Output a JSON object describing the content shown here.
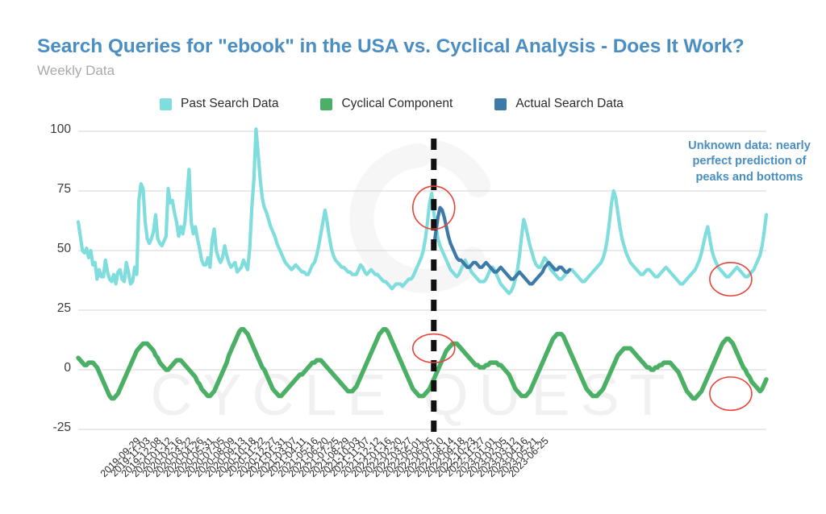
{
  "header": {
    "title": "Search Queries for \"ebook\" in the USA vs. Cyclical Analysis - Does It Work?",
    "subtitle": "Weekly Data",
    "title_color": "#4a8ec2",
    "subtitle_color": "#a9a9a9"
  },
  "watermark": {
    "text": "CYCLE QUEST"
  },
  "annotation": {
    "text": "Unknown data: nearly perfect prediction of peaks and bottoms",
    "color": "#4a8ec2"
  },
  "legend": {
    "position": "top-center",
    "items": [
      {
        "label": "Past Search Data",
        "color": "#7FDDDD",
        "icon": "square-swatch"
      },
      {
        "label": "Cyclical Component",
        "color": "#4CAF66",
        "icon": "square-swatch"
      },
      {
        "label": "Actual Search Data",
        "color": "#3D7AA8",
        "icon": "square-swatch"
      }
    ]
  },
  "chart_data": {
    "type": "line",
    "title": "Search Queries for \"ebook\" in the USA vs. Cyclical Analysis - Does It Work?",
    "subtitle": "Weekly Data",
    "xlabel": "",
    "ylabel": "",
    "ylim": [
      -25,
      100
    ],
    "yticks": [
      -25,
      0,
      25,
      50,
      75,
      100
    ],
    "ytick_labels": [
      "-25",
      "0",
      "25",
      "50",
      "75",
      "100"
    ],
    "grid": true,
    "grid_color": "#d6d6d6",
    "xtick_labels": [
      "2019-09-29",
      "2019-11-03",
      "2019-12-08",
      "2020-01-12",
      "2020-02-16",
      "2020-03-22",
      "2020-04-26",
      "2020-05-31",
      "2020-07-05",
      "2020-08-09",
      "2020-09-13",
      "2020-10-18",
      "2020-11-22",
      "2020-12-27",
      "2021-01-31",
      "2021-03-07",
      "2021-04-11",
      "2021-05-16",
      "2021-06-20",
      "2021-07-25",
      "2021-08-29",
      "2021-10-03",
      "2021-11-07",
      "2021-12-12",
      "2022-01-16",
      "2022-02-20",
      "2022-03-27",
      "2022-05-01",
      "2022-06-05",
      "2022-07-10",
      "2022-08-14",
      "2022-09-18",
      "2022-10-23",
      "2022-11-27",
      "2023-01-01",
      "2023-02-05",
      "2023-03-12",
      "2023-04-16",
      "2023-05-21",
      "2023-06-25"
    ],
    "xtick_interval_weeks": 5,
    "x_start": "2019-09-29",
    "x_end": "2023-07-02",
    "divider": {
      "x_label": "2023-01-01",
      "style": "dashed",
      "color": "#111111",
      "width": 7
    },
    "series": [
      {
        "name": "Past Search Data",
        "color": "#7FDDDD",
        "x_start_index": 0,
        "values": [
          62,
          56,
          50,
          49,
          51,
          47,
          50,
          44,
          45,
          38,
          42,
          39,
          39,
          46,
          41,
          38,
          37,
          40,
          36,
          41,
          42,
          38,
          37,
          45,
          41,
          36,
          37,
          43,
          40,
          71,
          78,
          76,
          62,
          55,
          53,
          55,
          58,
          65,
          55,
          53,
          52,
          54,
          56,
          76,
          70,
          71,
          66,
          62,
          56,
          60,
          57,
          62,
          73,
          84,
          62,
          57,
          60,
          55,
          51,
          46,
          44,
          44,
          47,
          43,
          54,
          59,
          50,
          47,
          45,
          47,
          52,
          48,
          45,
          43,
          44,
          45,
          41,
          42,
          43,
          46,
          44,
          42,
          51,
          68,
          80,
          101,
          91,
          80,
          72,
          68,
          66,
          63,
          60,
          58,
          56,
          53,
          51,
          49,
          47,
          45,
          44,
          43,
          42,
          43,
          44,
          43,
          42,
          41,
          41,
          40,
          40,
          42,
          44,
          45,
          48,
          52,
          57,
          62,
          67,
          62,
          56,
          51,
          48,
          46,
          45,
          44,
          43,
          43,
          42,
          41,
          41,
          40,
          40,
          40,
          42,
          44,
          43,
          41,
          40,
          41,
          42,
          41,
          40,
          40,
          39,
          38,
          37,
          37,
          36,
          35,
          34,
          35,
          36,
          36,
          36,
          35,
          36,
          37,
          38,
          38,
          39,
          41,
          43,
          45,
          47,
          50,
          55,
          62,
          70,
          74,
          66,
          60,
          55,
          52,
          50,
          48,
          46,
          44,
          42,
          41,
          40,
          39,
          40,
          42,
          44,
          46,
          44,
          43,
          41,
          40,
          39,
          38,
          37,
          37,
          37,
          38,
          40,
          42,
          43,
          42,
          40,
          38,
          36,
          35,
          34,
          33,
          32,
          33,
          35,
          38,
          42,
          48,
          56,
          63,
          60,
          56,
          52,
          49,
          46,
          44,
          43,
          43,
          45,
          47,
          46,
          44,
          42,
          41,
          40,
          39,
          38,
          38,
          39,
          40,
          41,
          42,
          42,
          41,
          40,
          39,
          38,
          37,
          37,
          38,
          39,
          40,
          41,
          42,
          43,
          44,
          45,
          47,
          50,
          55,
          62,
          70,
          75,
          72,
          66,
          60,
          55,
          52,
          49,
          47,
          45,
          44,
          43,
          42,
          41,
          40,
          40,
          41,
          42,
          42,
          41,
          40,
          39,
          39,
          40,
          41,
          42,
          43,
          42,
          41,
          40,
          39,
          38,
          37,
          36,
          36,
          37,
          38,
          39,
          40,
          41,
          42,
          44,
          46,
          49,
          53,
          57,
          60,
          55,
          50,
          47,
          45,
          43,
          42,
          41,
          40,
          39,
          39,
          40,
          41,
          42,
          43,
          42,
          41,
          40,
          39,
          39,
          40,
          41,
          42,
          44,
          46,
          48,
          52,
          58,
          65
        ]
      },
      {
        "name": "Actual Search Data",
        "color": "#3D7AA8",
        "x_start_index": 170,
        "values": [
          51,
          58,
          64,
          68,
          67,
          64,
          60,
          56,
          53,
          51,
          49,
          47,
          46,
          46,
          45,
          44,
          43,
          43,
          44,
          45,
          45,
          44,
          43,
          43,
          44,
          45,
          44,
          43,
          42,
          41,
          41,
          42,
          43,
          42,
          41,
          40,
          39,
          38,
          38,
          39,
          40,
          41,
          40,
          39,
          38,
          37,
          36,
          36,
          37,
          38,
          39,
          40,
          41,
          43,
          44,
          45,
          44,
          43,
          42,
          42,
          43,
          43,
          42,
          41,
          41,
          42
        ]
      },
      {
        "name": "Cyclical Component",
        "color": "#4CAF66",
        "x_start_index": 0,
        "values": [
          5,
          4,
          3,
          2,
          2,
          3,
          3,
          3,
          2,
          1,
          -1,
          -3,
          -5,
          -7,
          -9,
          -11,
          -12,
          -12,
          -11,
          -10,
          -8,
          -6,
          -4,
          -2,
          0,
          2,
          4,
          6,
          8,
          9,
          10,
          11,
          11,
          11,
          10,
          9,
          8,
          6,
          5,
          3,
          2,
          1,
          0,
          0,
          1,
          2,
          3,
          4,
          4,
          4,
          3,
          2,
          1,
          0,
          -1,
          -2,
          -3,
          -5,
          -6,
          -8,
          -9,
          -10,
          -11,
          -11,
          -10,
          -9,
          -7,
          -5,
          -3,
          -1,
          1,
          3,
          6,
          8,
          10,
          12,
          14,
          16,
          17,
          17,
          16,
          15,
          13,
          11,
          9,
          7,
          5,
          3,
          1,
          0,
          -2,
          -4,
          -6,
          -8,
          -9,
          -10,
          -11,
          -11,
          -10,
          -9,
          -8,
          -7,
          -6,
          -5,
          -4,
          -3,
          -2,
          -2,
          -1,
          0,
          1,
          2,
          3,
          3,
          4,
          4,
          4,
          3,
          2,
          1,
          0,
          -1,
          -2,
          -3,
          -4,
          -5,
          -6,
          -7,
          -8,
          -9,
          -9,
          -9,
          -8,
          -7,
          -5,
          -3,
          -1,
          1,
          3,
          5,
          7,
          9,
          11,
          13,
          15,
          16,
          17,
          17,
          16,
          14,
          12,
          10,
          8,
          6,
          4,
          2,
          0,
          -2,
          -4,
          -6,
          -8,
          -9,
          -10,
          -11,
          -11,
          -11,
          -10,
          -9,
          -8,
          -6,
          -4,
          -2,
          0,
          2,
          4,
          6,
          8,
          9,
          10,
          11,
          11,
          11,
          10,
          9,
          8,
          7,
          6,
          5,
          4,
          3,
          2,
          2,
          1,
          1,
          1,
          2,
          2,
          3,
          3,
          3,
          3,
          2,
          2,
          1,
          0,
          -1,
          -2,
          -4,
          -6,
          -8,
          -9,
          -10,
          -11,
          -11,
          -11,
          -10,
          -9,
          -7,
          -5,
          -3,
          -1,
          1,
          3,
          5,
          7,
          9,
          11,
          13,
          14,
          15,
          15,
          15,
          14,
          12,
          10,
          8,
          6,
          4,
          2,
          0,
          -2,
          -4,
          -6,
          -8,
          -9,
          -10,
          -11,
          -11,
          -11,
          -10,
          -9,
          -8,
          -6,
          -4,
          -2,
          0,
          2,
          4,
          6,
          7,
          8,
          9,
          9,
          9,
          9,
          8,
          7,
          6,
          5,
          4,
          3,
          2,
          1,
          1,
          0,
          0,
          1,
          1,
          2,
          2,
          3,
          3,
          3,
          3,
          2,
          1,
          0,
          -1,
          -3,
          -5,
          -7,
          -9,
          -10,
          -11,
          -12,
          -12,
          -11,
          -10,
          -9,
          -7,
          -5,
          -3,
          -1,
          1,
          3,
          5,
          7,
          9,
          11,
          12,
          13,
          13,
          12,
          11,
          9,
          7,
          5,
          3,
          1,
          0,
          -2,
          -3,
          -5,
          -6,
          -7,
          -8,
          -9,
          -8,
          -6,
          -4
        ]
      }
    ],
    "highlight_ellipses": [
      {
        "cx_label": "2023-01-01",
        "cy_value": 68,
        "rx_weeks": 4,
        "ry_value": 9,
        "color": "#e8443a",
        "series": "Actual Search Data",
        "note": "peak"
      },
      {
        "cx_label": "2023-05-28",
        "cy_value": 38,
        "rx_weeks": 5,
        "ry_value": 7,
        "color": "#e8443a",
        "series": "Actual Search Data",
        "note": "bottom"
      },
      {
        "cx_label": "2023-01-01",
        "cy_value": 9,
        "rx_weeks": 5,
        "ry_value": 6,
        "color": "#e8443a",
        "series": "Cyclical Component",
        "note": "peak"
      },
      {
        "cx_label": "2023-05-28",
        "cy_value": -10,
        "rx_weeks": 6,
        "ry_value": 7,
        "color": "#e8443a",
        "series": "Cyclical Component",
        "note": "bottom"
      }
    ]
  }
}
